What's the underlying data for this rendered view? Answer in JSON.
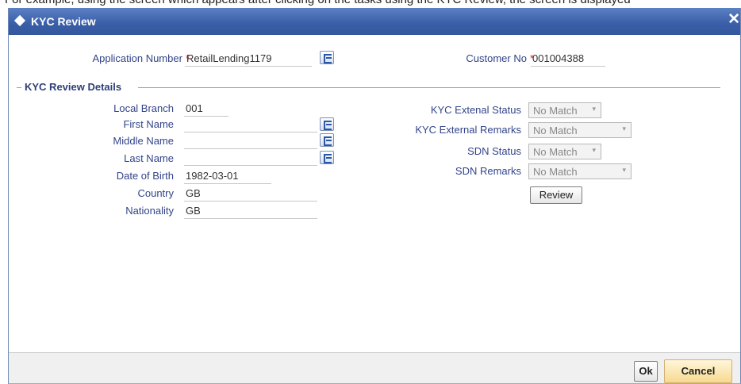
{
  "page": {
    "top_text": "For example, using the screen which appears after clicking on the tasks using the KYC Review, the screen is displayed"
  },
  "window": {
    "title": "KYC Review",
    "close_glyph": "✕"
  },
  "header": {
    "application_number_label": "Application Number",
    "application_number_value": "RetailLending1179",
    "customer_no_label": "Customer No",
    "customer_no_value": "001004388",
    "required_marker": "*"
  },
  "section": {
    "title": "KYC Review Details"
  },
  "left_fields": {
    "local_branch_label": "Local Branch",
    "local_branch_value": "001",
    "first_name_label": "First Name",
    "first_name_value": "",
    "middle_name_label": "Middle Name",
    "middle_name_value": "",
    "last_name_label": "Last Name",
    "last_name_value": "",
    "dob_label": "Date of Birth",
    "dob_value": "1982-03-01",
    "country_label": "Country",
    "country_value": "GB",
    "nationality_label": "Nationality",
    "nationality_value": "GB"
  },
  "right_fields": {
    "kyc_external_status_label": "KYC Extenal Status",
    "kyc_external_status_value": "No Match",
    "kyc_external_remarks_label": "KYC External Remarks",
    "kyc_external_remarks_value": "No Match",
    "sdn_status_label": "SDN Status",
    "sdn_status_value": "No Match",
    "sdn_remarks_label": "SDN Remarks",
    "sdn_remarks_value": "No Match",
    "review_button": "Review",
    "dropdown_glyph": "▾"
  },
  "footer": {
    "ok_label": "Ok",
    "cancel_label": "Cancel"
  },
  "icons": {
    "lov": "list-of-values-icon",
    "diamond": "diamond-icon",
    "close": "close-icon"
  },
  "colors": {
    "titlebar": "#3a5ea7",
    "label_text": "#33448a",
    "required": "#e2232a",
    "cancel_button": "#f7d98e"
  }
}
